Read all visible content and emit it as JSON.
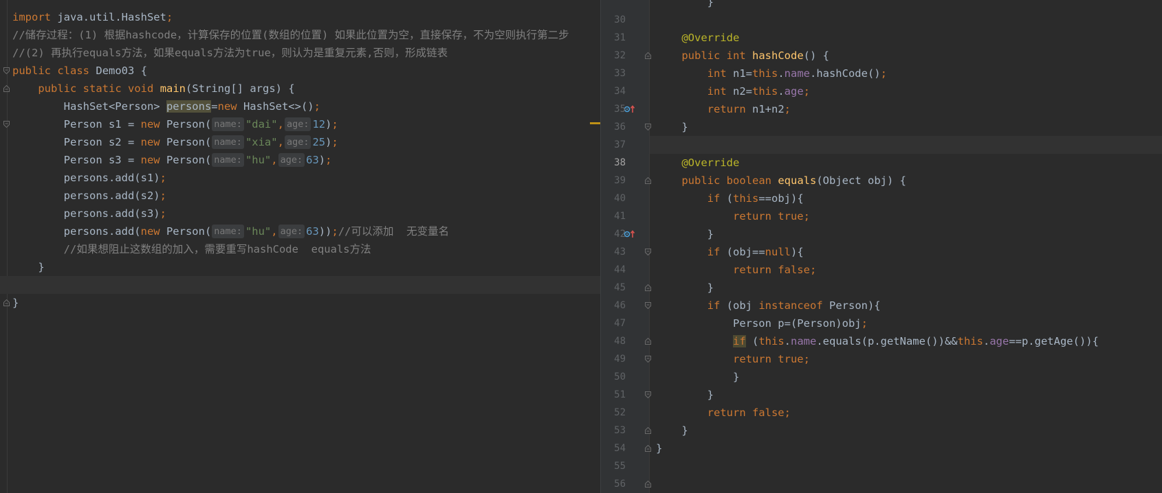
{
  "left_editor": {
    "line1": {
      "kw": "import",
      "rest": " java.util.HashSet",
      "semi": ";"
    },
    "line2": {
      "comment": "//储存过程：(1) 根据hashcode，计算保存的位置(数组的位置) 如果此位置为空，直接保存，不为空则执行第二步"
    },
    "line3": {
      "comment": "//(2) 再执行equals方法，如果equals方法为true，则认为是重复元素,否则，形成链表"
    },
    "line4": {
      "kw1": "public",
      "kw2": "class",
      "name": "Demo03",
      "brace": "{"
    },
    "line5": {
      "kw1": "public",
      "kw2": "static",
      "kw3": "void",
      "fn": "main",
      "params": "(String[] args) {"
    },
    "line6": {
      "type": "HashSet<Person> ",
      "var": "persons",
      "eq": "=",
      "kw": "new",
      "ctor": " HashSet<>()",
      "semi": ";"
    },
    "persons": [
      {
        "decl": "Person s1 = ",
        "kw": "new",
        "ctor": " Person(",
        "hint_name": "name:",
        "str": "\"dai\"",
        "comma": ",",
        "hint_age": "age:",
        "num": "12",
        "close": ")",
        "semi": ";"
      },
      {
        "decl": "Person s2 = ",
        "kw": "new",
        "ctor": " Person(",
        "hint_name": "name:",
        "str": "\"xia\"",
        "comma": ",",
        "hint_age": "age:",
        "num": "25",
        "close": ")",
        "semi": ";"
      },
      {
        "decl": "Person s3 = ",
        "kw": "new",
        "ctor": " Person(",
        "hint_name": "name:",
        "str": "\"hu\"",
        "comma": ",",
        "hint_age": "age:",
        "num": "63",
        "close": ")",
        "semi": ";"
      }
    ],
    "adds": [
      {
        "call": "persons.add(s1)",
        "semi": ";"
      },
      {
        "call": "persons.add(s2)",
        "semi": ";"
      },
      {
        "call": "persons.add(s3)",
        "semi": ";"
      }
    ],
    "line13": {
      "call": "persons.add(",
      "kw": "new",
      "ctor": " Person(",
      "hint_name": "name:",
      "str": "\"hu\"",
      "comma": ",",
      "hint_age": "age:",
      "num": "63",
      "close": "))",
      "semi": ";",
      "comment": "//可以添加  无变量名"
    },
    "line14": {
      "comment": "//如果想阻止这数组的加入，需要重写hashCode  equals方法"
    },
    "line15": {
      "brace": "}"
    },
    "line17": {
      "brace": "}"
    }
  },
  "right_editor": {
    "line_numbers": [
      "30",
      "31",
      "32",
      "33",
      "34",
      "35",
      "36",
      "37",
      "38",
      "39",
      "40",
      "41",
      "42",
      "43",
      "44",
      "45",
      "46",
      "47",
      "48",
      "49",
      "50",
      "51",
      "52",
      "53",
      "54",
      "55",
      "56"
    ],
    "l30": {
      "brace": "}"
    },
    "l32": {
      "ann": "@Override"
    },
    "l33": {
      "kw1": "public",
      "kw2": "int",
      "fn": "hashCode",
      "rest": "() {"
    },
    "l34": {
      "kw": "int",
      "a": " n1=",
      "this": "this",
      "dot": ".",
      "fld": "name",
      "b": ".hashCode()",
      "semi": ";"
    },
    "l35": {
      "kw": "int",
      "a": " n2=",
      "this": "this",
      "dot": ".",
      "fld": "age",
      "semi": ";"
    },
    "l36": {
      "kw": "return",
      "a": " n1+n2",
      "semi": ";"
    },
    "l37": {
      "brace": "}"
    },
    "l39": {
      "ann": "@Override"
    },
    "l40": {
      "kw1": "public",
      "kw2": "boolean",
      "fn": "equals",
      "rest": "(Object obj) {"
    },
    "l41": {
      "kw": "if",
      "a": " (",
      "this": "this",
      "b": "==obj){"
    },
    "l42": {
      "kw": "return true;"
    },
    "l43": {
      "brace": "}"
    },
    "l44": {
      "kw": "if",
      "a": " (obj==",
      "null": "null",
      "b": "){"
    },
    "l45": {
      "kw": "return false;"
    },
    "l46": {
      "brace": "}"
    },
    "l47": {
      "kw": "if",
      "a": " (obj ",
      "kw2": "instanceof",
      "b": " Person){"
    },
    "l48": {
      "a": "Person p=(Person)obj",
      "semi": ";"
    },
    "l49": {
      "kw": "if",
      "a": " (",
      "this1": "this",
      "d1": ".",
      "fld1": "name",
      "b": ".equals(p.getName())&&",
      "this2": "this",
      "d2": ".",
      "fld2": "age",
      "c": "==p.getAge()){"
    },
    "l50": {
      "kw": "return true;"
    },
    "l51": {
      "brace": "}"
    },
    "l52": {
      "brace": "}"
    },
    "l53": {
      "kw": "return false;"
    },
    "l54": {
      "brace": "}"
    },
    "l55": {
      "brace": "}"
    }
  },
  "icons": [
    "fold-open-icon",
    "fold-end-icon",
    "override-icon"
  ],
  "colors": {
    "keyword": "#cc7832",
    "string": "#6a8759",
    "number": "#6897bb",
    "comment": "#808080",
    "function": "#ffc66d",
    "field": "#9876aa",
    "annotation": "#bbb529",
    "background": "#2b2b2b"
  }
}
